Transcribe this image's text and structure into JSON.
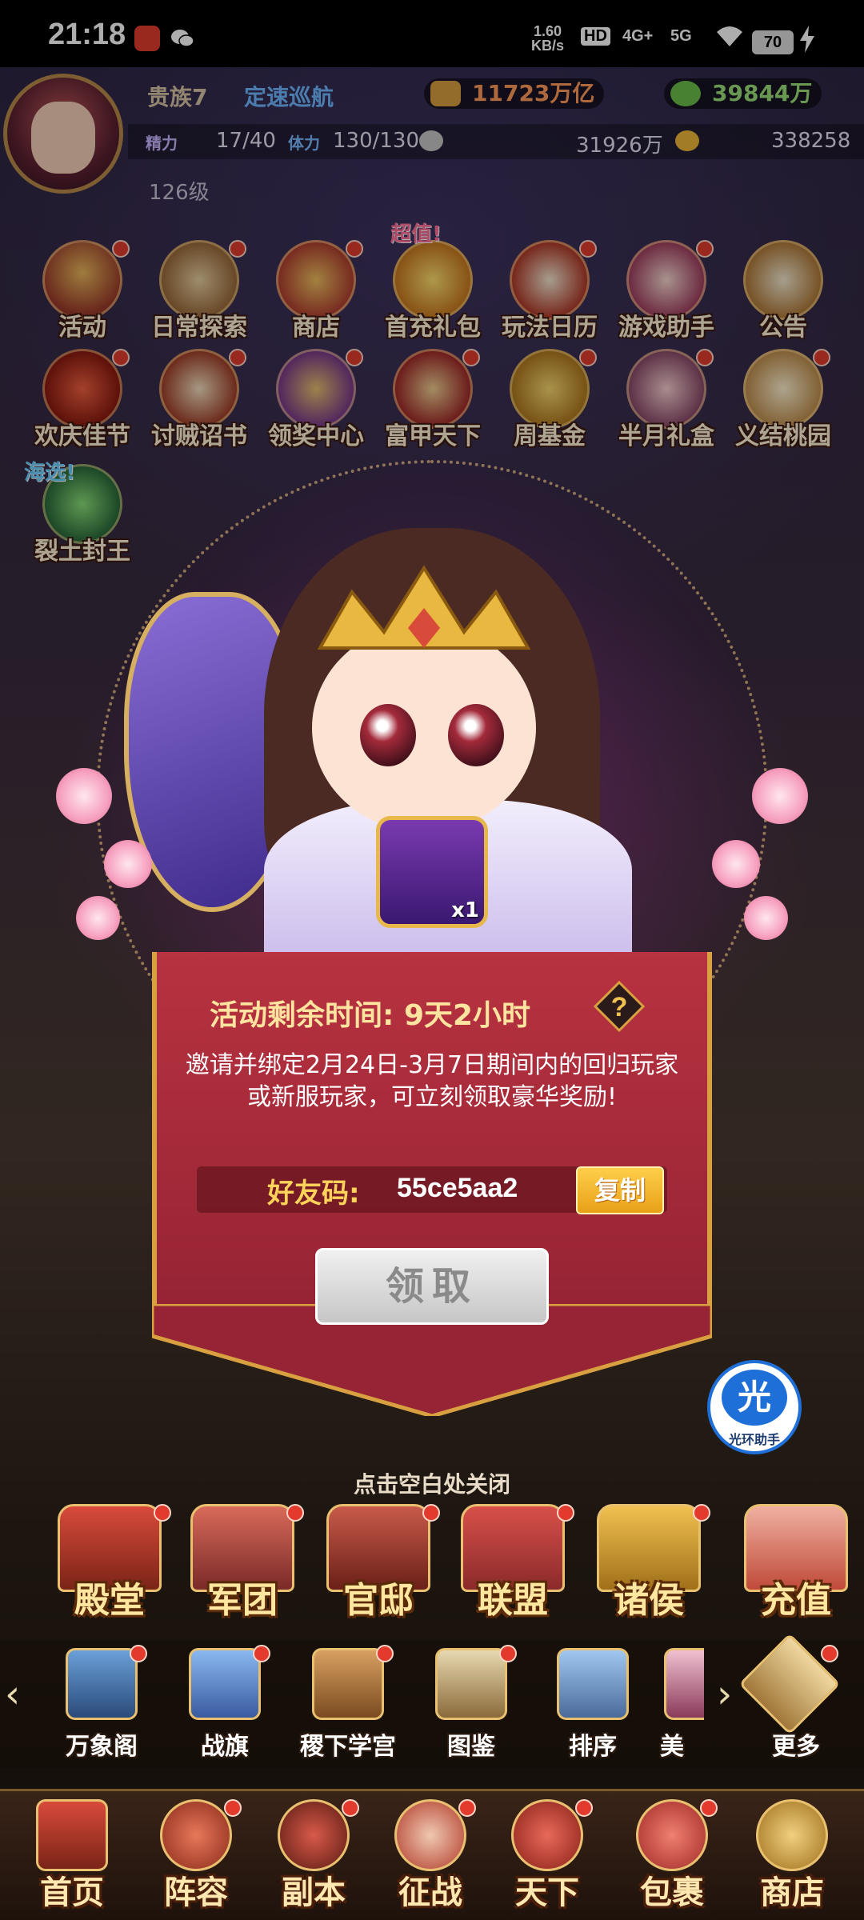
{
  "status_bar": {
    "time": "21:18",
    "speed_value": "1.60",
    "speed_unit": "KB/s",
    "hd": "HD",
    "network_4g": "4G+",
    "network_5g": "5G",
    "battery": "70"
  },
  "player": {
    "vip": "贵族7",
    "speed_mode": "定速巡航",
    "power": "11723万亿",
    "paw_currency": "39844万",
    "stamina_label": "精力",
    "stamina": "17/40",
    "vigor_label": "体力",
    "vigor": "130/130",
    "silver": "31926万",
    "gold": "338258",
    "level": "126级"
  },
  "activities_row1": [
    {
      "label": "活动"
    },
    {
      "label": "日常探索"
    },
    {
      "label": "商店"
    },
    {
      "label": "首充礼包",
      "tag": "超值!"
    },
    {
      "label": "玩法日历"
    },
    {
      "label": "游戏助手"
    },
    {
      "label": "公告"
    }
  ],
  "activities_row2": [
    {
      "label": "欢庆佳节"
    },
    {
      "label": "讨贼诏书"
    },
    {
      "label": "领奖中心"
    },
    {
      "label": "富甲天下"
    },
    {
      "label": "周基金"
    },
    {
      "label": "半月礼盒"
    },
    {
      "label": "义结桃园"
    }
  ],
  "activities_row3": [
    {
      "label": "裂土封王",
      "tag": "海选!"
    }
  ],
  "popup": {
    "reward_count": "x1",
    "timer_label": "活动剩余时间:",
    "timer_value": "9天2小时",
    "help": "?",
    "description": "邀请并绑定2月24日-3月7日期间内的回归玩家或新服玩家，可立刻领取豪华奖励!",
    "code_label": "好友码:",
    "code_value": "55ce5aa2",
    "copy_label": "复制",
    "claim_label": "领取",
    "close_hint": "点击空白处关闭"
  },
  "helper": {
    "icon_char": "光",
    "label": "光环助手"
  },
  "main_buildings": [
    {
      "label": "殿堂"
    },
    {
      "label": "军团"
    },
    {
      "label": "官邸"
    },
    {
      "label": "联盟"
    },
    {
      "label": "诸侯"
    },
    {
      "label": "充值"
    }
  ],
  "secondary_row": [
    {
      "label": "万象阁"
    },
    {
      "label": "战旗"
    },
    {
      "label": "稷下学宫"
    },
    {
      "label": "图鉴"
    },
    {
      "label": "排序"
    },
    {
      "label": "美"
    },
    {
      "label": "更多"
    }
  ],
  "bottom_nav": [
    {
      "label": "首页"
    },
    {
      "label": "阵容"
    },
    {
      "label": "副本"
    },
    {
      "label": "征战"
    },
    {
      "label": "天下"
    },
    {
      "label": "包裹"
    },
    {
      "label": "商店"
    }
  ],
  "colors": {
    "panel_red": "#b83240",
    "gold_trim": "#d8a040",
    "code_yellow": "#ffd35a",
    "red_dot": "#e23b2e",
    "helper_blue": "#1e6fd8"
  }
}
